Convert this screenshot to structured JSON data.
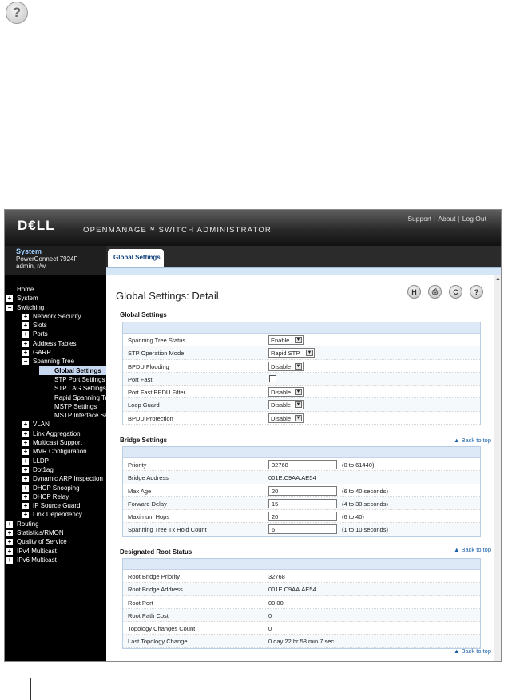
{
  "banner": {
    "logo": "D€LL",
    "product": "OPENMANAGE™ SWITCH ADMINISTRATOR",
    "links": [
      "Support",
      "About",
      "Log Out"
    ],
    "separator": "|"
  },
  "system": {
    "title": "System",
    "model": "PowerConnect 7924F",
    "user": "admin, r/w"
  },
  "tabs": [
    {
      "label": "Global Settings"
    }
  ],
  "nav": [
    {
      "label": "Home",
      "level": 0,
      "expander": ""
    },
    {
      "label": "System",
      "level": 0,
      "expander": "+"
    },
    {
      "label": "Switching",
      "level": 0,
      "expander": "−"
    },
    {
      "label": "Network Security",
      "level": 1,
      "expander": "+"
    },
    {
      "label": "Slots",
      "level": 1,
      "expander": "+"
    },
    {
      "label": "Ports",
      "level": 1,
      "expander": "+"
    },
    {
      "label": "Address Tables",
      "level": 1,
      "expander": "+"
    },
    {
      "label": "GARP",
      "level": 1,
      "expander": "+"
    },
    {
      "label": "Spanning Tree",
      "level": 1,
      "expander": "−"
    },
    {
      "label": "Global Settings",
      "level": 2,
      "expander": "",
      "active": true
    },
    {
      "label": "STP Port Settings",
      "level": 2,
      "expander": ""
    },
    {
      "label": "STP LAG Settings",
      "level": 2,
      "expander": ""
    },
    {
      "label": "Rapid Spanning Tree",
      "level": 2,
      "expander": ""
    },
    {
      "label": "MSTP Settings",
      "level": 2,
      "expander": ""
    },
    {
      "label": "MSTP Interface Settings",
      "level": 2,
      "expander": ""
    },
    {
      "label": "VLAN",
      "level": 1,
      "expander": "+"
    },
    {
      "label": "Link Aggregation",
      "level": 1,
      "expander": "+"
    },
    {
      "label": "Multicast Support",
      "level": 1,
      "expander": "+"
    },
    {
      "label": "MVR Configuration",
      "level": 1,
      "expander": "+"
    },
    {
      "label": "LLDP",
      "level": 1,
      "expander": "+"
    },
    {
      "label": "Dot1ag",
      "level": 1,
      "expander": "+"
    },
    {
      "label": "Dynamic ARP Inspection",
      "level": 1,
      "expander": "+"
    },
    {
      "label": "DHCP Snooping",
      "level": 1,
      "expander": "+"
    },
    {
      "label": "DHCP Relay",
      "level": 1,
      "expander": "+"
    },
    {
      "label": "IP Source Guard",
      "level": 1,
      "expander": "+"
    },
    {
      "label": "Link Dependency",
      "level": 1,
      "expander": "+"
    },
    {
      "label": "Routing",
      "level": 0,
      "expander": "+"
    },
    {
      "label": "Statistics/RMON",
      "level": 0,
      "expander": "+"
    },
    {
      "label": "Quality of Service",
      "level": 0,
      "expander": "+"
    },
    {
      "label": "IPv4 Multicast",
      "level": 0,
      "expander": "+"
    },
    {
      "label": "IPv6 Multicast",
      "level": 0,
      "expander": "+"
    }
  ],
  "page": {
    "title": "Global Settings: Detail",
    "icons": [
      {
        "name": "help-icon",
        "glyph": "?"
      },
      {
        "name": "refresh-icon",
        "glyph": "C"
      },
      {
        "name": "print-icon",
        "glyph": "⎙"
      },
      {
        "name": "hide-icon",
        "glyph": "H"
      }
    ],
    "back_to_top": "▲ Back to top"
  },
  "global_settings": {
    "heading": "Global Settings",
    "rows": [
      {
        "label": "Spanning Tree Status",
        "kind": "select",
        "value": "Enable"
      },
      {
        "label": "STP Operation Mode",
        "kind": "select",
        "value": "Rapid STP"
      },
      {
        "label": "BPDU Flooding",
        "kind": "select",
        "value": "Disable"
      },
      {
        "label": "Port Fast",
        "kind": "checkbox",
        "value": ""
      },
      {
        "label": "Port Fast BPDU Filter",
        "kind": "select",
        "value": "Disable"
      },
      {
        "label": "Loop Guard",
        "kind": "select",
        "value": "Disable"
      },
      {
        "label": "BPDU Protection",
        "kind": "select",
        "value": "Disable"
      }
    ]
  },
  "bridge_settings": {
    "heading": "Bridge Settings",
    "rows": [
      {
        "label": "Priority",
        "kind": "input",
        "value": "32768",
        "hint": "(0 to 61440)"
      },
      {
        "label": "Bridge Address",
        "kind": "text",
        "value": "001E.C9AA.AE54",
        "hint": ""
      },
      {
        "label": "Max Age",
        "kind": "input",
        "value": "20",
        "hint": "(6 to 40 seconds)"
      },
      {
        "label": "Forward Delay",
        "kind": "input",
        "value": "15",
        "hint": "(4 to 30 seconds)"
      },
      {
        "label": "Maximum Hops",
        "kind": "input",
        "value": "20",
        "hint": "(6 to 40)"
      },
      {
        "label": "Spanning Tree Tx Hold Count",
        "kind": "input",
        "value": "6",
        "hint": "(1 to 10 seconds)"
      }
    ]
  },
  "designated_root": {
    "heading": "Designated Root Status",
    "rows": [
      {
        "label": "Root Bridge Priority",
        "value": "32768"
      },
      {
        "label": "Root Bridge Address",
        "value": "001E.C9AA.AE54"
      },
      {
        "label": "Root Port",
        "value": "00:00"
      },
      {
        "label": "Root Path Cost",
        "value": "0"
      },
      {
        "label": "Topology Changes Count",
        "value": "0"
      },
      {
        "label": "Last Topology Change",
        "value": "0 day 22 hr 58 min 7 sec"
      }
    ]
  }
}
